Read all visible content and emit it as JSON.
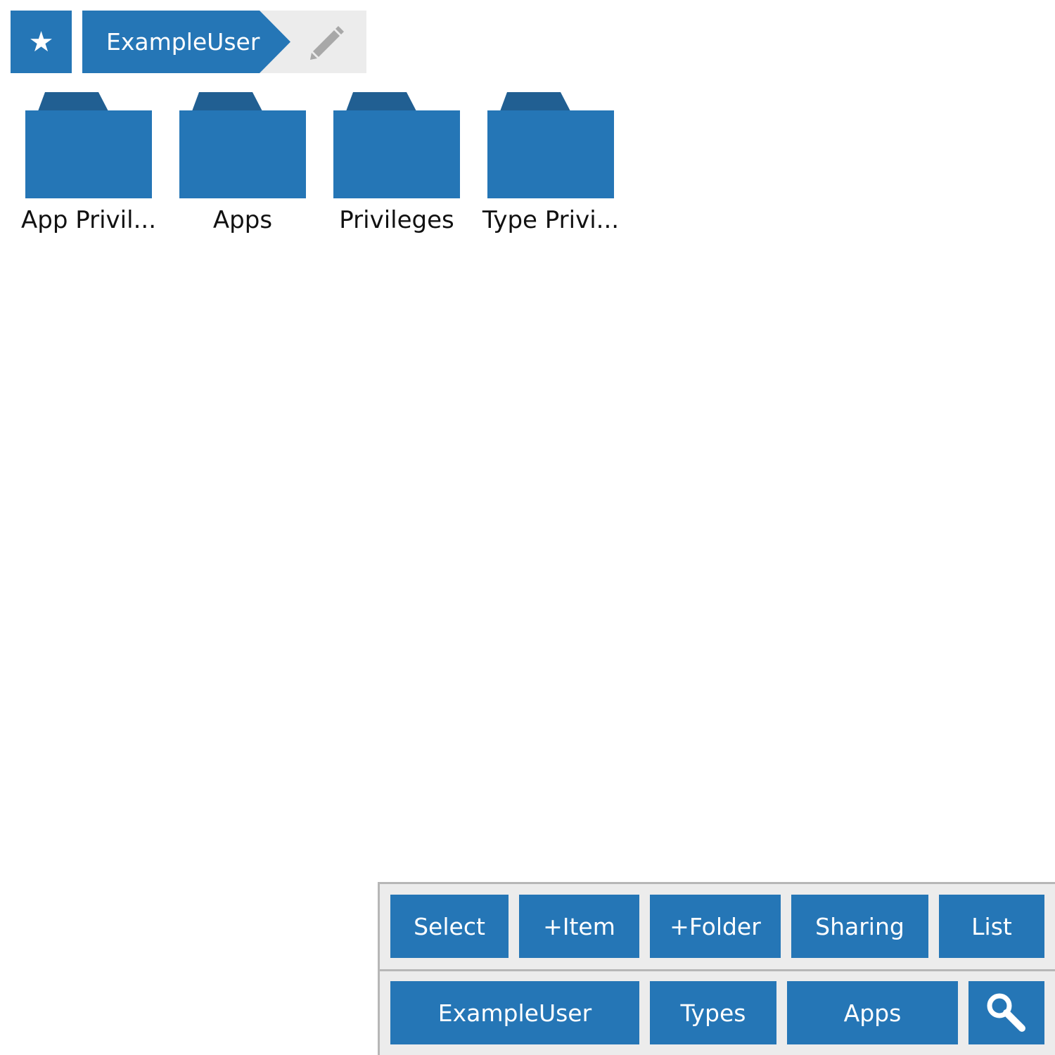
{
  "breadcrumb": {
    "home_icon": "star-icon",
    "current": "ExampleUser",
    "edit_icon": "pencil-icon"
  },
  "folders": [
    {
      "label": "App Privil..."
    },
    {
      "label": "Apps"
    },
    {
      "label": "Privileges"
    },
    {
      "label": "Type Privi..."
    }
  ],
  "toolbar": {
    "row1": {
      "select": "Select",
      "add_item": "+Item",
      "add_folder": "+Folder",
      "sharing": "Sharing",
      "list": "List"
    },
    "row2": {
      "user": "ExampleUser",
      "types": "Types",
      "apps": "Apps",
      "search_icon": "magnifier-icon"
    }
  },
  "colors": {
    "accent": "#2576b6",
    "folder_tab": "#215f92",
    "toolbar_bg": "#ececec"
  }
}
